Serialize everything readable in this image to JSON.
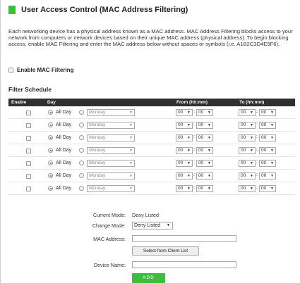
{
  "section": {
    "title": "User Access Control (MAC Address Filtering)",
    "description": "Each networking device has a physical address known as a MAC address. MAC Address Filtering blocks access to your network from computers or network devices based on their unique MAC address (physical address). To begin blocking access, enable MAC Filtering and enter the MAC address below without spaces or symbols (i.e. A1B2C3D4E5F6)."
  },
  "enable_mac_filtering": {
    "label": "Enable MAC Filtering",
    "checked": false
  },
  "filter_schedule": {
    "title": "Filter Schedule",
    "columns": {
      "enable": "Enable",
      "day": "Day",
      "from": "From (hh:mm)",
      "to": "To (hh:mm)"
    },
    "rows": [
      {
        "all_day_label": "All Day",
        "day": "Monday",
        "from_h": "00",
        "from_m": "00",
        "to_h": "00",
        "to_m": "00"
      },
      {
        "all_day_label": "All Day",
        "day": "Monday",
        "from_h": "00",
        "from_m": "00",
        "to_h": "00",
        "to_m": "00"
      },
      {
        "all_day_label": "All Day",
        "day": "Monday",
        "from_h": "00",
        "from_m": "00",
        "to_h": "00",
        "to_m": "00"
      },
      {
        "all_day_label": "All Day",
        "day": "Monday",
        "from_h": "00",
        "from_m": "00",
        "to_h": "00",
        "to_m": "00"
      },
      {
        "all_day_label": "All Day",
        "day": "Monday",
        "from_h": "00",
        "from_m": "00",
        "to_h": "00",
        "to_m": "00"
      },
      {
        "all_day_label": "All Day",
        "day": "Monday",
        "from_h": "00",
        "from_m": "00",
        "to_h": "00",
        "to_m": "00"
      },
      {
        "all_day_label": "All Day",
        "day": "Monday",
        "from_h": "00",
        "from_m": "00",
        "to_h": "00",
        "to_m": "00"
      }
    ]
  },
  "form": {
    "current_mode_label": "Current Mode:",
    "current_mode_value": "Deny Listed",
    "change_mode_label": "Change Mode:",
    "change_mode_value": "Deny Listed",
    "mac_address_label": "MAC Address:",
    "mac_address_value": "",
    "select_client_label": "Select from Client List",
    "device_name_label": "Device Name:",
    "device_name_value": "",
    "add_label": "ADD"
  },
  "colors": {
    "accent": "#3bbf3b",
    "table_header": "#2f2f2f"
  }
}
